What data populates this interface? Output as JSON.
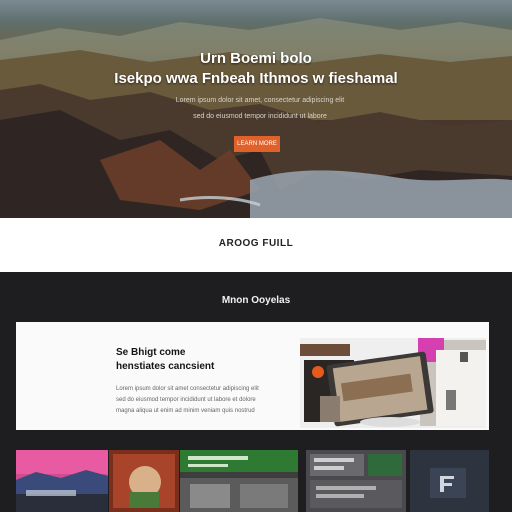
{
  "hero": {
    "title_line1": "Urn Boemi bolo",
    "title_line2": "Isekpo wwa Fnbeah Ithmos w fieshamal",
    "sub_line1": "Lorem ipsum dolor sit amet, consectetur adipiscing elit",
    "sub_line2": "sed do eiusmod tempor incididunt ut labore",
    "cta_label": "LEARN MORE"
  },
  "section1": {
    "title": "AROOG FUILL"
  },
  "section2": {
    "title": "Mnon Ooyelas"
  },
  "feature_card": {
    "heading_line1": "Se Bhigt come",
    "heading_line2": "henstiates cancsient",
    "body_line1": "Lorem ipsum dolor sit amet consectetur adipiscing elit",
    "body_line2": "sed do eiusmod tempor incididunt ut labore et dolore",
    "body_line3": "magna aliqua ut enim ad minim veniam quis nostrud"
  },
  "colors": {
    "accent": "#e0622a",
    "dark_bg": "#1e1e20",
    "card_bg": "#fafafa"
  }
}
